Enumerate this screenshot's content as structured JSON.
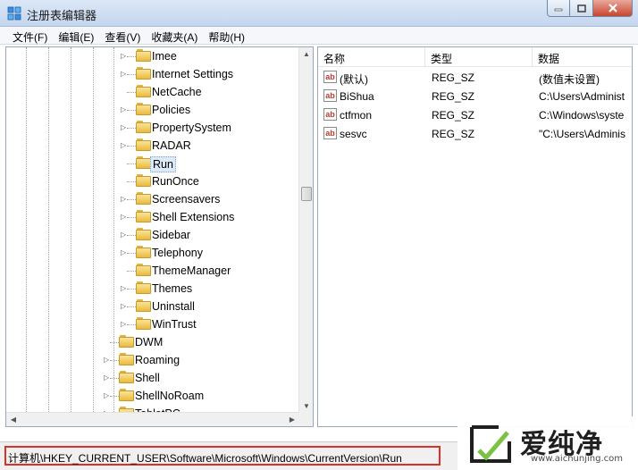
{
  "window": {
    "title": "注册表编辑器"
  },
  "menu": [
    {
      "label": "文件(F)"
    },
    {
      "label": "编辑(E)"
    },
    {
      "label": "查看(V)"
    },
    {
      "label": "收藏夹(A)"
    },
    {
      "label": "帮助(H)"
    }
  ],
  "tree": {
    "items": [
      {
        "label": "Imee",
        "expandable": true,
        "level": 2
      },
      {
        "label": "Internet Settings",
        "expandable": true,
        "level": 2
      },
      {
        "label": "NetCache",
        "expandable": false,
        "level": 2
      },
      {
        "label": "Policies",
        "expandable": true,
        "level": 2
      },
      {
        "label": "PropertySystem",
        "expandable": true,
        "level": 2
      },
      {
        "label": "RADAR",
        "expandable": true,
        "level": 2
      },
      {
        "label": "Run",
        "expandable": false,
        "level": 2,
        "selected": true
      },
      {
        "label": "RunOnce",
        "expandable": false,
        "level": 2
      },
      {
        "label": "Screensavers",
        "expandable": true,
        "level": 2
      },
      {
        "label": "Shell Extensions",
        "expandable": true,
        "level": 2
      },
      {
        "label": "Sidebar",
        "expandable": true,
        "level": 2
      },
      {
        "label": "Telephony",
        "expandable": true,
        "level": 2
      },
      {
        "label": "ThemeManager",
        "expandable": false,
        "level": 2
      },
      {
        "label": "Themes",
        "expandable": true,
        "level": 2
      },
      {
        "label": "Uninstall",
        "expandable": true,
        "level": 2
      },
      {
        "label": "WinTrust",
        "expandable": true,
        "level": 2
      },
      {
        "label": "DWM",
        "expandable": false,
        "level": 1
      },
      {
        "label": "Roaming",
        "expandable": true,
        "level": 1
      },
      {
        "label": "Shell",
        "expandable": true,
        "level": 1
      },
      {
        "label": "ShellNoRoam",
        "expandable": true,
        "level": 1
      },
      {
        "label": "TabletPC",
        "expandable": true,
        "level": 1
      }
    ]
  },
  "list": {
    "columns": [
      {
        "label": "名称"
      },
      {
        "label": "类型"
      },
      {
        "label": "数据"
      }
    ],
    "rows": [
      {
        "name": "(默认)",
        "type": "REG_SZ",
        "data": "(数值未设置)"
      },
      {
        "name": "BiShua",
        "type": "REG_SZ",
        "data": "C:\\Users\\Administ"
      },
      {
        "name": "ctfmon",
        "type": "REG_SZ",
        "data": "C:\\Windows\\syste"
      },
      {
        "name": "sesvc",
        "type": "REG_SZ",
        "data": "\"C:\\Users\\Adminis"
      }
    ],
    "value_icon_text": "ab"
  },
  "status": {
    "path": "计算机\\HKEY_CURRENT_USER\\Software\\Microsoft\\Windows\\CurrentVersion\\Run"
  },
  "watermark": {
    "name": "爱纯净",
    "url": "www.aichunjing.com"
  },
  "colors": {
    "highlight_border": "#d9322b",
    "selection_bg": "#dce9f8",
    "folder": "#e9bb3c"
  }
}
